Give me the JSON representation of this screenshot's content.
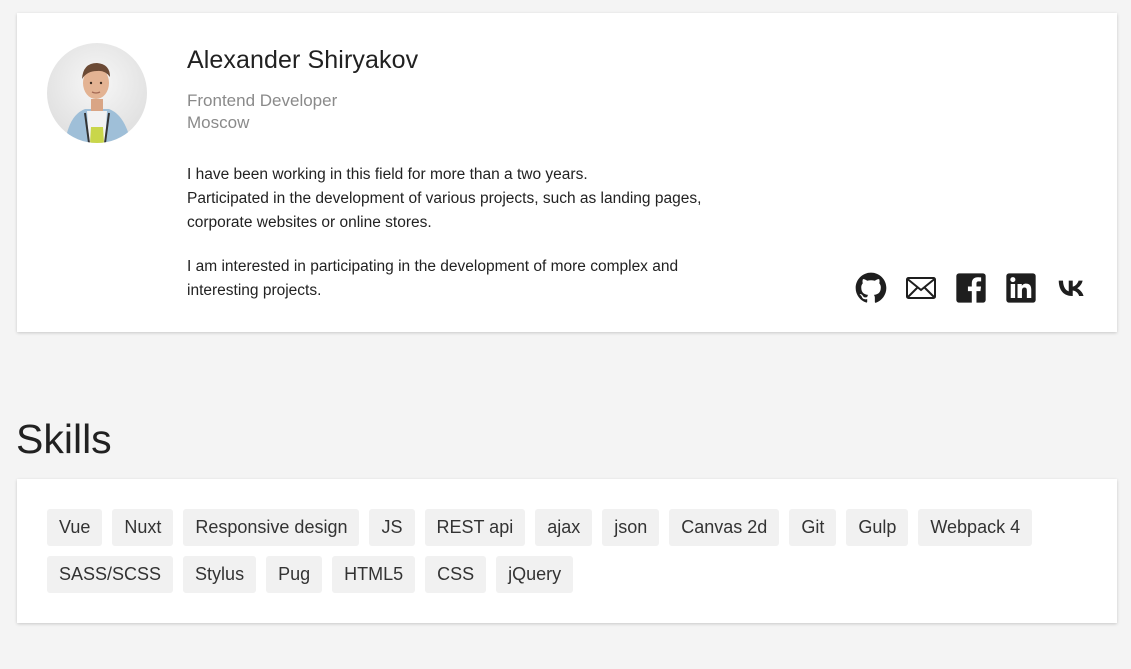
{
  "profile": {
    "name": "Alexander Shiryakov",
    "role": "Frontend Developer",
    "city": "Moscow",
    "about": [
      "I have been working in this field for more than a two years.",
      "Participated in the development of various projects, such as landing pages,",
      "corporate websites or online stores.",
      "I am interested in participating in the development of more complex and",
      "interesting projects."
    ]
  },
  "social": [
    {
      "icon": "github-icon"
    },
    {
      "icon": "mail-icon"
    },
    {
      "icon": "facebook-icon"
    },
    {
      "icon": "linkedin-icon"
    },
    {
      "icon": "vk-icon"
    }
  ],
  "skills": {
    "title": "Skills",
    "items": [
      "Vue",
      "Nuxt",
      "Responsive design",
      "JS",
      "REST api",
      "ajax",
      "json",
      "Canvas 2d",
      "Git",
      "Gulp",
      "Webpack 4",
      "SASS/SCSS",
      "Stylus",
      "Pug",
      "HTML5",
      "CSS",
      "jQuery"
    ]
  },
  "colors": {
    "background": "#f4f4f4",
    "card": "#ffffff",
    "tag_bg": "#f1f1f1",
    "secondary_text": "#8a8a8a"
  }
}
